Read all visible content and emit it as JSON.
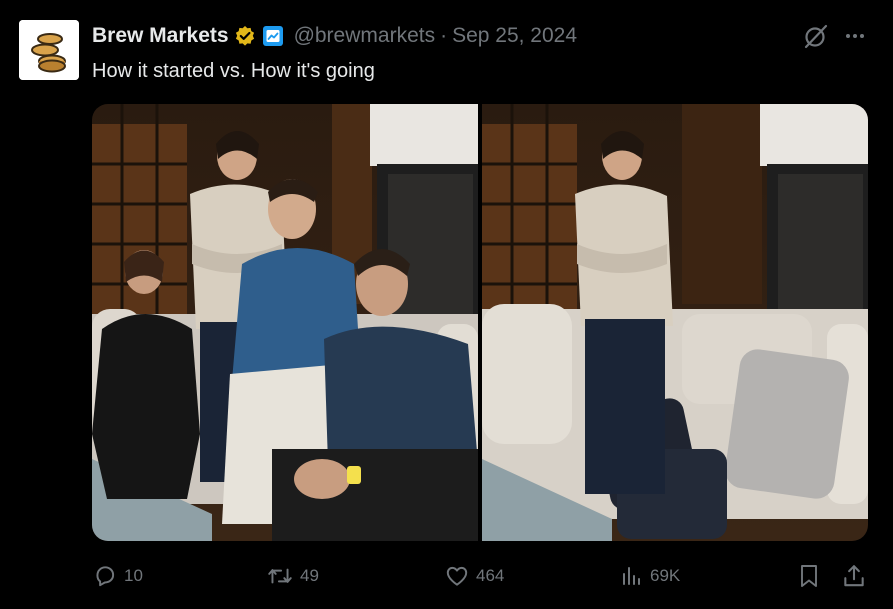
{
  "author": {
    "display_name": "Brew Markets",
    "handle": "@brewmarkets",
    "separator": "·",
    "date": "Sep 25, 2024"
  },
  "tweet": {
    "text": "How it started vs. How it's going"
  },
  "media": [
    {
      "name": "photo-before"
    },
    {
      "name": "photo-after"
    }
  ],
  "actions": {
    "replies": "10",
    "reposts": "49",
    "likes": "464",
    "views": "69K"
  },
  "colors": {
    "background": "#000000",
    "text_primary": "#e7e9ea",
    "text_secondary": "#71767b",
    "verified_gold": "#e2b719",
    "affiliate_blue": "#1d9bf0"
  },
  "icons": [
    "verified-badge-icon",
    "affiliate-badge-icon",
    "grok-icon",
    "more-icon",
    "reply-icon",
    "repost-icon",
    "like-icon",
    "views-icon",
    "bookmark-icon",
    "share-icon"
  ]
}
